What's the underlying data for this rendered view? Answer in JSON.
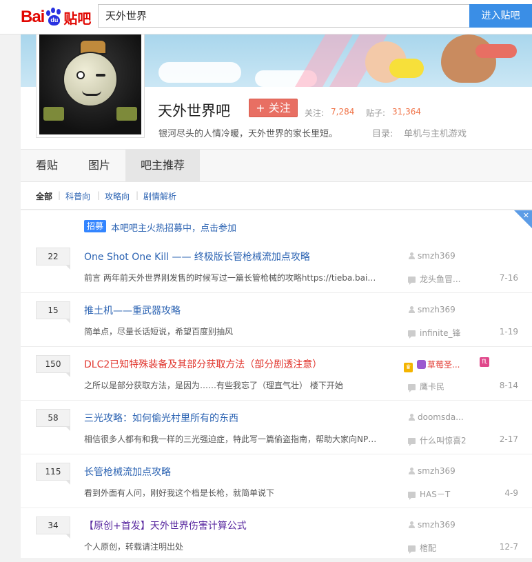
{
  "header": {
    "logo_text_1": "Bai",
    "logo_paw_text": "du",
    "logo_text_2": "贴吧",
    "search_value": "天外世界",
    "enter_button": "进入贴吧"
  },
  "forum": {
    "name": "天外世界吧",
    "follow_label": "+ 关注",
    "followers_label": "关注:",
    "followers_count": "7,284",
    "posts_label": "贴子:",
    "posts_count": "31,364",
    "slogan": "银河尽头的人情冷暖，天外世界的家长里短。",
    "category_label": "目录:",
    "category_value": "单机与主机游戏"
  },
  "tabs": [
    {
      "label": "看贴"
    },
    {
      "label": "图片"
    },
    {
      "label": "吧主推荐",
      "active": true
    }
  ],
  "subnav": [
    {
      "label": "全部",
      "active": true
    },
    {
      "label": "科普向"
    },
    {
      "label": "攻略向"
    },
    {
      "label": "剧情解析"
    }
  ],
  "recruit": {
    "tag": "招募",
    "text": "本吧吧主火热招募中，点击参加"
  },
  "threads": [
    {
      "replies": "22",
      "title": "One Shot One Kill —— 终极版长管枪械流加点攻略",
      "abstract": "前言 两年前天外世界刚发售的时候写过一篇长管枪械的攻略https://tieba.baidu.com",
      "author": "smzh369",
      "last_replier": "龙头鱼冒...",
      "date": "7-16"
    },
    {
      "replies": "15",
      "title": "推土机——重武器攻略",
      "abstract": "简单点，尽量长话短说，希望百度别抽风",
      "author": "smzh369",
      "last_replier": "infinite_锋",
      "date": "1-19"
    },
    {
      "replies": "150",
      "title": "DLC2已知特殊装备及其部分获取方法（部分剧透注意）",
      "abstract": "之所以是部分获取方法，是因为……有些我忘了（理直气壮） 楼下开始",
      "author": "草莓圣...",
      "last_replier": "鹰卡民",
      "date": "8-14",
      "style": "red"
    },
    {
      "replies": "58",
      "title": "三光攻略：如何偷光村里所有的东西",
      "abstract": "相信很多人都有和我一样的三光强迫症，特此写一篇偷盗指南，帮助大家向NPC说",
      "author": "doomsda...",
      "last_replier": "什么叫惊喜2",
      "date": "2-17"
    },
    {
      "replies": "115",
      "title": "长管枪械流加点攻略",
      "abstract": "看到外面有人问，刚好我这个档是长枪，就简单说下",
      "author": "smzh369",
      "last_replier": "HAS－T",
      "date": "4-9"
    },
    {
      "replies": "34",
      "title": "【原创+首发】天外世界伤害计算公式",
      "abstract": "个人原创，转载请注明出处",
      "author": "smzh369",
      "last_replier": "棺配",
      "date": "12-7",
      "style": "purple"
    }
  ],
  "colors": {
    "accent_blue": "#3a8ee6",
    "link_blue": "#2d64b3",
    "follow_red": "#e86f63",
    "count_orange": "#f07246",
    "title_red": "#e1352d"
  }
}
